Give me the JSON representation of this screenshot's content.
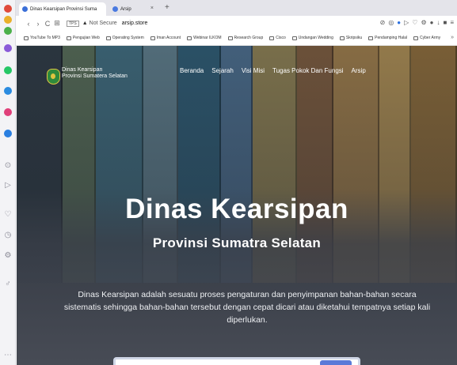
{
  "browser": {
    "tabs": [
      {
        "title": "Dinas Kearsipan Provinsi Suma",
        "active": true
      },
      {
        "title": "Arsip",
        "active": false
      }
    ],
    "new_tab_icon": "+",
    "nav": {
      "back": "‹",
      "forward": "›",
      "reload": "C",
      "apps": "⊞"
    },
    "tabs_badge": "TPS",
    "security_label": "Not Secure",
    "url": "arsip.store",
    "toolbar_icons": [
      "reader-icon",
      "extension-icon",
      "shield-icon",
      "play-icon",
      "pocket-icon",
      "settings-icon",
      "profile-icon",
      "download-icon",
      "battery-icon",
      "menu-icon"
    ],
    "bookmarks": [
      "YouTube To MP3",
      "Pengujian Web",
      "Operating System",
      "Iman Account",
      "Webinar ILKOM",
      "Research Group",
      "Cisco",
      "Undangan Wedding",
      "Skripsiku",
      "Pendamping Halal",
      "Cyber Army"
    ],
    "bookmarks_more": "»"
  },
  "site": {
    "brand_line1": "Dinas Kearsipan",
    "brand_line2": "Provinsi Sumatera Selatan",
    "menu": [
      "Beranda",
      "Sejarah",
      "Visi Misi",
      "Tugas Pokok Dan Fungsi",
      "Arsip"
    ],
    "hero_title": "Dinas Kearsipan",
    "hero_subtitle": "Provinsi Sumatra Selatan",
    "hero_description": "Dinas Kearsipan adalah sesuatu proses pengaturan dan penyimpanan bahan-bahan secara sistematis sehingga bahan-bahan tersebut dengan cepat dicari atau diketahui tempatnya setiap kali diperlukan."
  },
  "colors": {
    "sidebar_bg": "#f3f3f6",
    "hero_overlay": "#4a4f58",
    "logo_green": "#2f8a3c",
    "logo_gold": "#e0c440",
    "search_button": "#5a7ad8"
  }
}
